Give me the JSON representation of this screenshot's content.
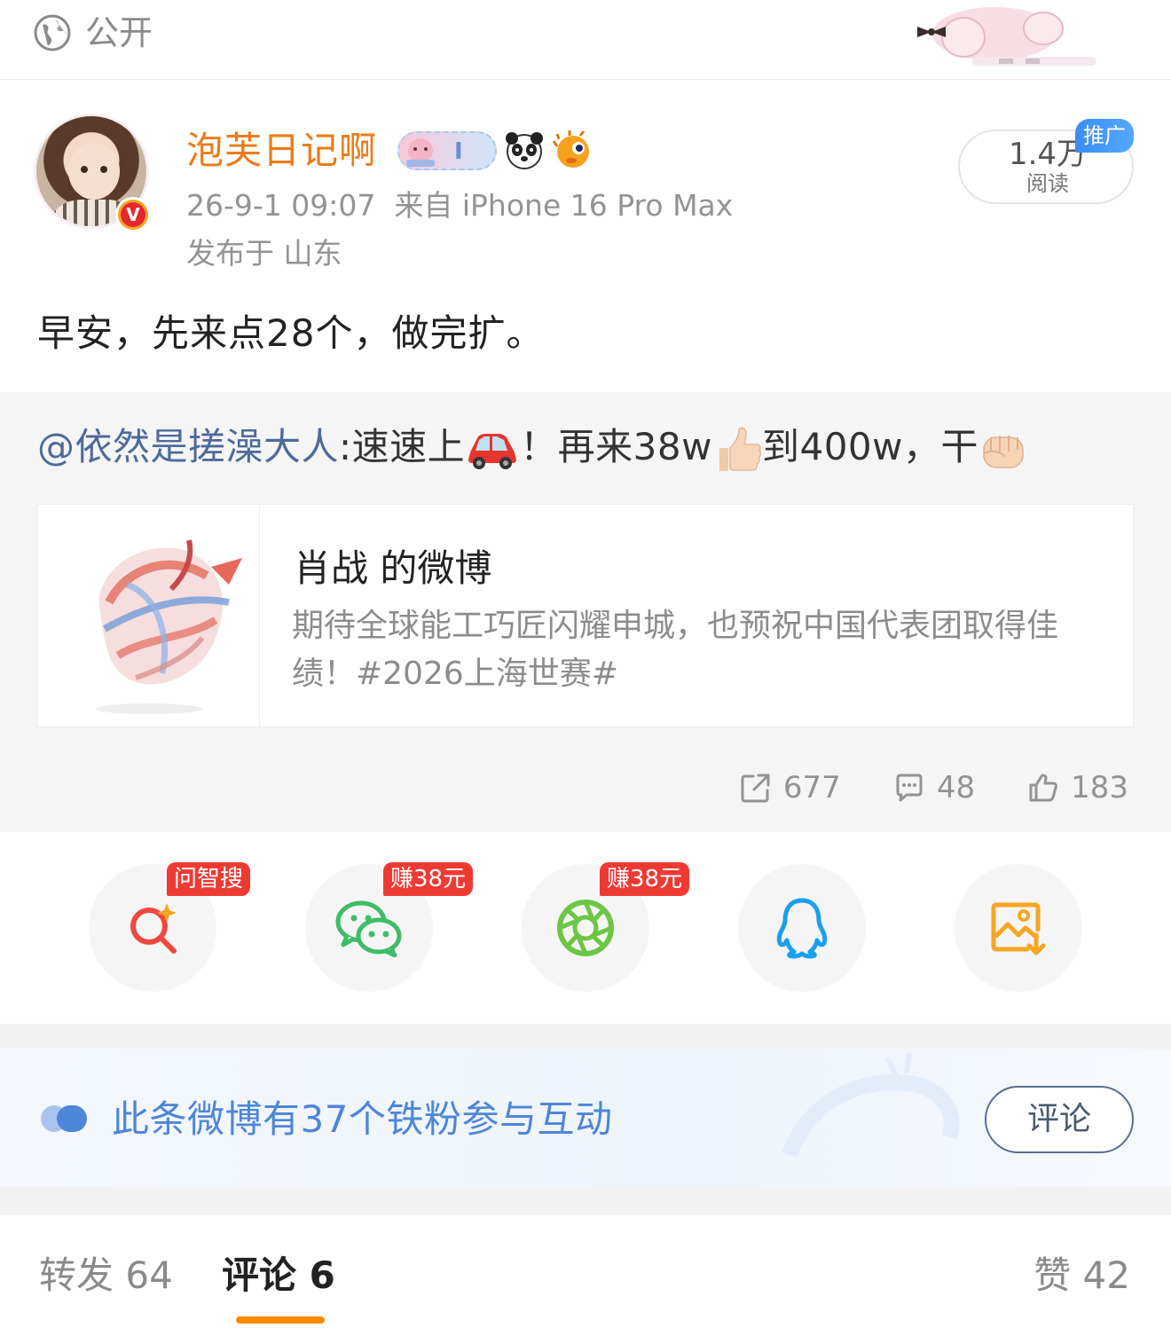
{
  "topbar": {
    "visibility_label": "公开"
  },
  "post": {
    "author": "泡芙日记啊",
    "verified_mark": "V",
    "timestamp": "26-9-1 09:07",
    "source": "来自 iPhone 16 Pro Max",
    "location": "发布于 山东",
    "reads_count": "1.4万",
    "reads_label": "阅读",
    "promo_tag": "推广",
    "text": "早安，先来点28个，做完扩。"
  },
  "repost": {
    "user": "@依然是搓澡大人",
    "text_part1": ":速速上",
    "text_part2": "！再来38w",
    "text_part3": "到400w，干",
    "card": {
      "title": "肖战 的微博",
      "desc": "期待全球能工巧匠闪耀申城，也预祝中国代表团取得佳绩！#2026上海世赛#"
    },
    "stats": {
      "reposts": "677",
      "comments": "48",
      "likes": "183"
    }
  },
  "share": {
    "items": [
      {
        "name": "smart-search",
        "tag": "问智搜",
        "color": "#f0483e"
      },
      {
        "name": "wechat",
        "tag": "赚38元",
        "color": "#3ebd66"
      },
      {
        "name": "moments",
        "tag": "赚38元",
        "color": "#6cc644"
      },
      {
        "name": "qq",
        "tag": "",
        "color": "#1a9ff0"
      },
      {
        "name": "save-image",
        "tag": "",
        "color": "#f5a623"
      }
    ]
  },
  "fans": {
    "text": "此条微博有37个铁粉参与互动",
    "button": "评论"
  },
  "tabs": {
    "repost": "转发 64",
    "comment": "评论 6",
    "like": "赞 42"
  },
  "colors": {
    "author_name": "#eb7b18",
    "link_blue": "#4d6b9a",
    "fans_blue": "#4e86d8",
    "tab_underline": "#ff8a00",
    "share_tag_red": "#ef3a34"
  }
}
